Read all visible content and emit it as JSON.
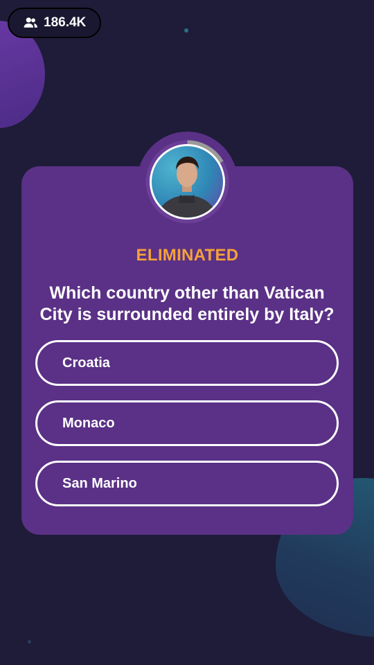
{
  "viewers": {
    "icon": "users-icon",
    "count": "186.4K"
  },
  "host": {
    "avatar_icon": "host-avatar",
    "timer_icon": "countdown-ring"
  },
  "question": {
    "status": "ELIMINATED",
    "text": "Which country other than Vatican City is surrounded entirely by Italy?"
  },
  "answers": [
    {
      "label": "Croatia"
    },
    {
      "label": "Monaco"
    },
    {
      "label": "San Marino"
    }
  ],
  "colors": {
    "background": "#1e1c38",
    "card": "#5a3186",
    "status": "#f5a23a",
    "text": "#ffffff"
  }
}
